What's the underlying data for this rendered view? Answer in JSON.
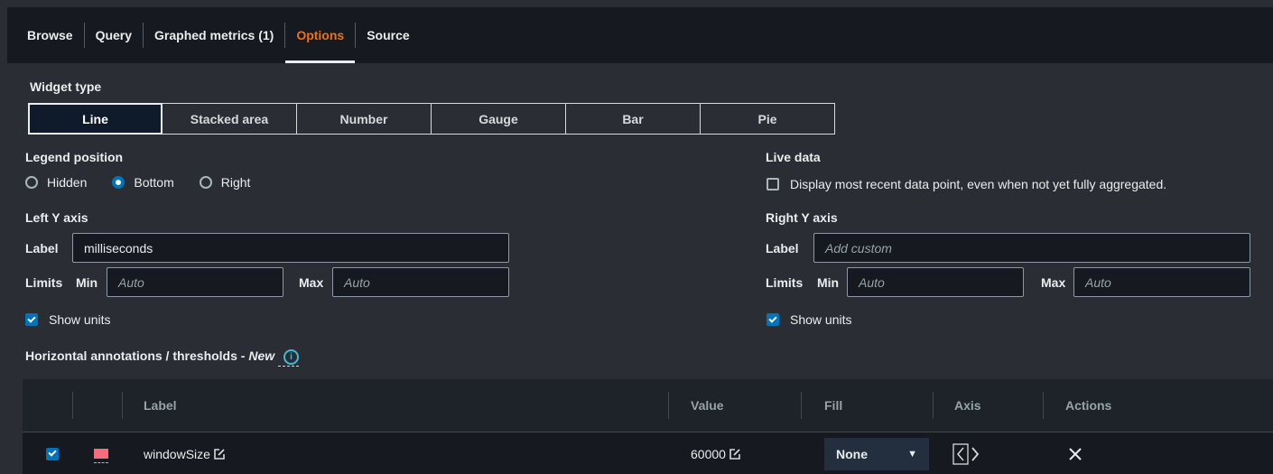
{
  "tabs": [
    {
      "label": "Browse"
    },
    {
      "label": "Query"
    },
    {
      "label": "Graphed metrics (1)"
    },
    {
      "label": "Options",
      "active": true
    },
    {
      "label": "Source"
    }
  ],
  "widget_type": {
    "heading": "Widget type",
    "options": [
      "Line",
      "Stacked area",
      "Number",
      "Gauge",
      "Bar",
      "Pie"
    ],
    "selected": "Line"
  },
  "legend_position": {
    "heading": "Legend position",
    "options": [
      "Hidden",
      "Bottom",
      "Right"
    ],
    "selected": "Bottom"
  },
  "live_data": {
    "heading": "Live data",
    "checkbox_label": "Display most recent data point, even when not yet fully aggregated.",
    "checked": false
  },
  "left_y": {
    "heading": "Left Y axis",
    "label_label": "Label",
    "label_value": "milliseconds",
    "limits_label": "Limits",
    "min_label": "Min",
    "min_placeholder": "Auto",
    "max_label": "Max",
    "max_placeholder": "Auto",
    "show_units_label": "Show units",
    "show_units": true
  },
  "right_y": {
    "heading": "Right Y axis",
    "label_label": "Label",
    "label_placeholder": "Add custom",
    "limits_label": "Limits",
    "min_label": "Min",
    "min_placeholder": "Auto",
    "max_label": "Max",
    "max_placeholder": "Auto",
    "show_units_label": "Show units",
    "show_units": true
  },
  "annotations": {
    "heading": "Horizontal annotations / thresholds - ",
    "heading_new": "New",
    "columns": {
      "label": "Label",
      "value": "Value",
      "fill": "Fill",
      "axis": "Axis",
      "actions": "Actions"
    },
    "rows": [
      {
        "checked": true,
        "color": "#f26d7d",
        "label": "windowSize",
        "value": "60000",
        "fill": "None"
      }
    ]
  },
  "colors": {
    "accent": "#ec7211",
    "primary": "#0073bb",
    "swatch": "#f26d7d"
  }
}
